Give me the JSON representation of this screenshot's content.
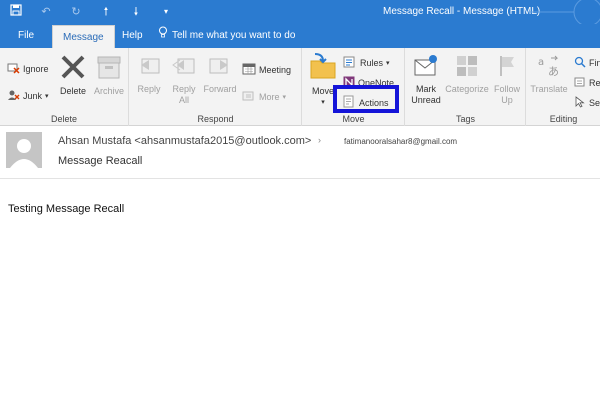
{
  "window": {
    "title": "Message Recall  -  Message (HTML)"
  },
  "qat": {
    "icons": [
      "save-icon",
      "undo-icon",
      "redo-icon",
      "up-arrow-icon",
      "down-arrow-icon",
      "customize-icon"
    ]
  },
  "tabs": [
    {
      "label": "File"
    },
    {
      "label": "Message"
    },
    {
      "label": "Help"
    }
  ],
  "tellme": {
    "label": "Tell me what you want to do"
  },
  "ribbon": {
    "delete_group": {
      "label": "Delete",
      "ignore": "Ignore",
      "junk": "Junk",
      "delete": "Delete",
      "archive": "Archive"
    },
    "respond_group": {
      "label": "Respond",
      "reply": "Reply",
      "reply_all_1": "Reply",
      "reply_all_2": "All",
      "forward": "Forward",
      "meeting": "Meeting",
      "more": "More"
    },
    "move_group": {
      "label": "Move",
      "move": "Move",
      "rules": "Rules",
      "onenote": "OneNote",
      "actions": "Actions"
    },
    "tags_group": {
      "label": "Tags",
      "mark_unread_1": "Mark",
      "mark_unread_2": "Unread",
      "categorize": "Categorize",
      "follow_up_1": "Follow",
      "follow_up_2": "Up"
    },
    "editing_group": {
      "label": "Editing",
      "translate": "Translate",
      "find": "Fin",
      "related": "Re",
      "select": "Se"
    }
  },
  "message": {
    "from": "Ahsan Mustafa <ahsanmustafa2015@outlook.com>",
    "to": "fatimanooralsahar8@gmail.com",
    "subject": "Message Reacall",
    "body": "Testing Message Recall"
  },
  "colors": {
    "accent": "#2b7bd0",
    "highlight_box": "#1414d8"
  }
}
